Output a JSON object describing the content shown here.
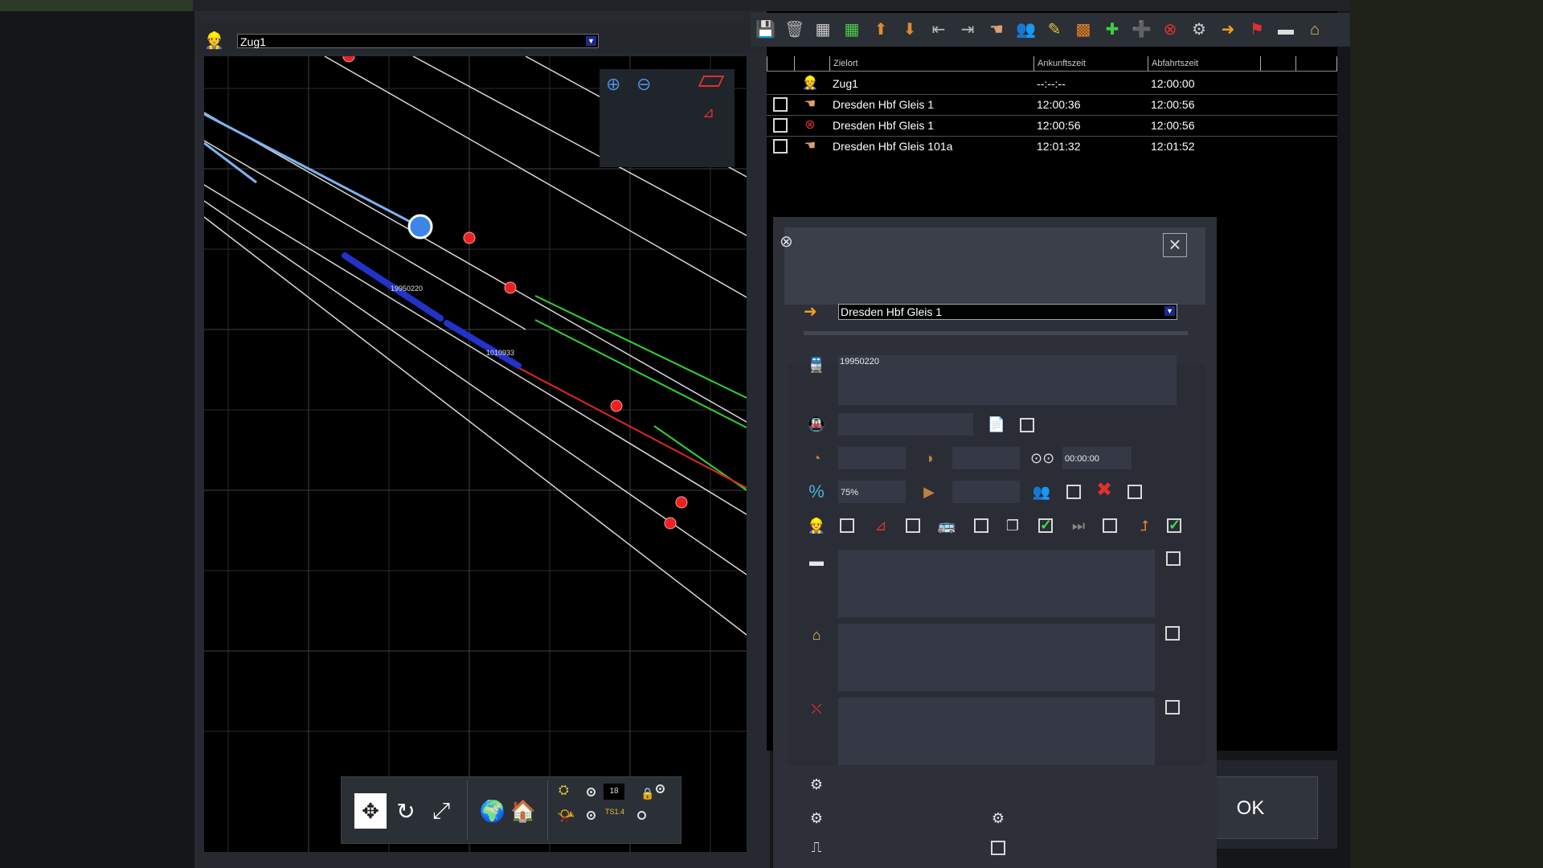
{
  "map": {
    "train_select": "Zug1",
    "train_labels": [
      "19950220",
      "1010933"
    ],
    "toolbar": {
      "counter": "18",
      "ts_label": "TS1.4"
    }
  },
  "toolbar_icons": [
    "save-icon",
    "delete-icon",
    "grid-icon",
    "grid-green-icon",
    "move-up-icon",
    "move-down-icon",
    "split-icon",
    "merge-icon",
    "hand-icon",
    "people-icon",
    "edit-icon",
    "grid-orange-icon",
    "add-after-icon",
    "add-icon",
    "remove-icon",
    "settings-icon",
    "arrive-icon",
    "flag-icon",
    "train-front-icon",
    "train-side-icon"
  ],
  "timetable": {
    "headers": [
      "Zielort",
      "Ankunftszeit",
      "Abfahrtszeit"
    ],
    "rows": [
      {
        "destination": "Zug1",
        "arrival": "--:--:--",
        "departure": "12:00:00",
        "icon": "driver-icon",
        "checkbox": false
      },
      {
        "destination": "Dresden Hbf Gleis 1",
        "arrival": "12:00:36",
        "departure": "12:00:56",
        "icon": "hand-icon",
        "checkbox": true
      },
      {
        "destination": "Dresden Hbf Gleis 1",
        "arrival": "12:00:56",
        "departure": "12:00:56",
        "icon": "no-stop-icon",
        "checkbox": true
      },
      {
        "destination": "Dresden Hbf Gleis 101a",
        "arrival": "12:01:32",
        "departure": "12:01:52",
        "icon": "hand-icon",
        "checkbox": true
      }
    ]
  },
  "dialog": {
    "destination": "Dresden Hbf Gleis 1",
    "train_number": "19950220",
    "time_field": "00:00:00",
    "percent": "75%",
    "ok_label": "OK"
  }
}
